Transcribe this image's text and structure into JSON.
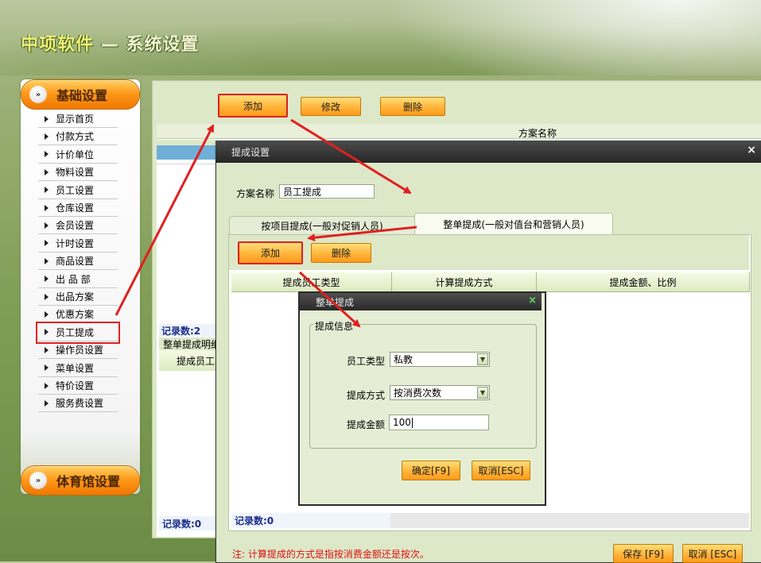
{
  "app": {
    "title_main": "中项软件",
    "title_sep": "—",
    "title_sub": "系统设置"
  },
  "sidebar": {
    "categories": [
      {
        "label": "基础设置"
      },
      {
        "label": "体育馆设置"
      }
    ],
    "items": [
      {
        "label": "显示首页"
      },
      {
        "label": "付款方式"
      },
      {
        "label": "计价单位"
      },
      {
        "label": "物料设置"
      },
      {
        "label": "员工设置"
      },
      {
        "label": "仓库设置"
      },
      {
        "label": "会员设置"
      },
      {
        "label": "计时设置"
      },
      {
        "label": "商品设置"
      },
      {
        "label": "出 品 部"
      },
      {
        "label": "出品方案"
      },
      {
        "label": "优惠方案"
      },
      {
        "label": "员工提成"
      },
      {
        "label": "操作员设置"
      },
      {
        "label": "菜单设置"
      },
      {
        "label": "特价设置"
      },
      {
        "label": "服务费设置"
      }
    ],
    "selected_index": 12
  },
  "main": {
    "toolbar": {
      "add": "添加",
      "edit": "修改",
      "delete": "删除"
    },
    "grid_header": "方案名称",
    "record_count_top": "记录数:2",
    "detail_label": "整单提成明细",
    "detail_col": "提成员工",
    "record_count_bottom": "记录数:0"
  },
  "dialog": {
    "title": "提成设置",
    "close": "×",
    "scheme_label": "方案名称",
    "scheme_value": "员工提成",
    "tabs": [
      {
        "label": "按项目提成(一般对促销人员)"
      },
      {
        "label": "整单提成(一般对值台和营销人员)"
      }
    ],
    "active_tab": 1,
    "toolbar": {
      "add": "添加",
      "delete": "删除"
    },
    "columns": [
      "提成员工类型",
      "计算提成方式",
      "提成金额、比例"
    ],
    "record_count": "记录数:0",
    "note": "注: 计算提成的方式是指按消费金额还是按次。",
    "save": "保存 [F9]",
    "cancel": "取消 [ESC]"
  },
  "subdialog": {
    "title": "整单提成",
    "close": "×",
    "group_title": "提成信息",
    "fields": {
      "employee_type_label": "员工类型",
      "employee_type_value": "私教",
      "method_label": "提成方式",
      "method_value": "按消费次数",
      "amount_label": "提成金额",
      "amount_value": "100"
    },
    "confirm": "确定[F9]",
    "cancel": "取消[ESC]"
  },
  "colors": {
    "accent_orange": "#ff9a1c",
    "annotation_red": "#e02020",
    "panel_green": "#dde8c9",
    "status_blue": "#1a2d8a"
  }
}
